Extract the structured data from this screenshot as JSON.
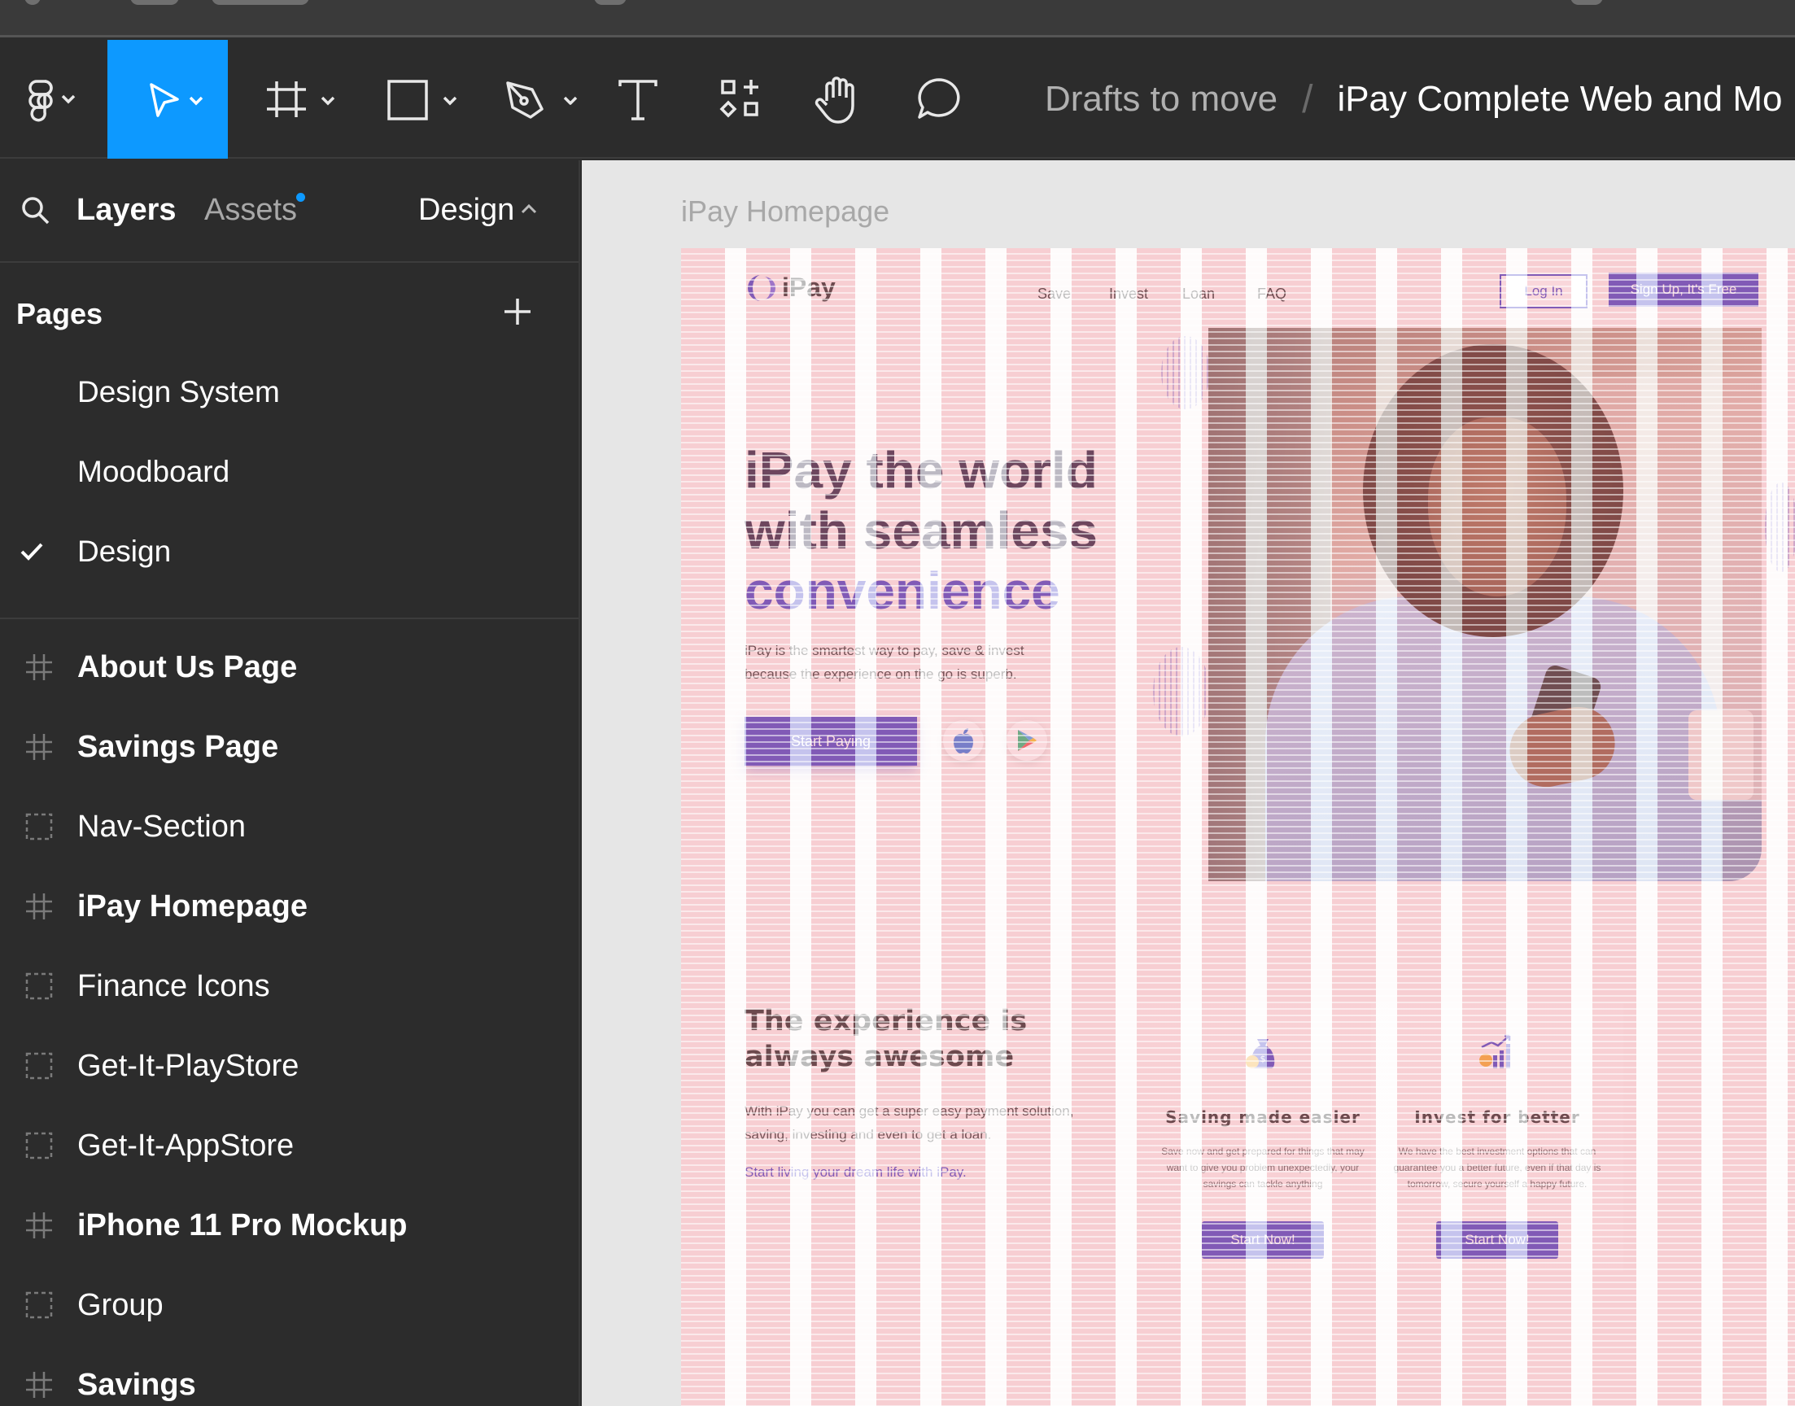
{
  "toolbar": {
    "breadcrumb": {
      "project": "Drafts to move",
      "separator": "/",
      "file": "iPay Complete Web and Mo"
    },
    "tools": [
      "main-menu",
      "move",
      "frame",
      "shape",
      "pen",
      "text",
      "resources",
      "hand",
      "comment"
    ]
  },
  "sidebar": {
    "tabs": {
      "layers": "Layers",
      "assets": "Assets",
      "design": "Design"
    },
    "pages_header": "Pages",
    "pages": [
      {
        "label": "Design System"
      },
      {
        "label": "Moodboard"
      },
      {
        "label": "Design",
        "selected": true
      }
    ],
    "layers": [
      {
        "label": "About Us Page",
        "type": "frame"
      },
      {
        "label": "Savings Page",
        "type": "frame"
      },
      {
        "label": "Nav-Section",
        "type": "group"
      },
      {
        "label": "iPay Homepage",
        "type": "frame"
      },
      {
        "label": "Finance Icons",
        "type": "group"
      },
      {
        "label": "Get-It-PlayStore",
        "type": "group"
      },
      {
        "label": "Get-It-AppStore",
        "type": "group"
      },
      {
        "label": "iPhone 11 Pro Mockup",
        "type": "frame"
      },
      {
        "label": "Group",
        "type": "group"
      },
      {
        "label": "Savings",
        "type": "frame"
      }
    ]
  },
  "canvas": {
    "frame_label": "iPay Homepage",
    "site": {
      "logo": "iPay",
      "nav": [
        "Save",
        "Invest",
        "Loan",
        "FAQ"
      ],
      "login": "Log In",
      "signup": "Sign Up, It's Free",
      "hero_line1": "iPay the world",
      "hero_line2": "with seamless",
      "hero_accent": "convenience",
      "hero_sub": "iPay is the smartest way to pay, save & invest because the experience on the go is superb.",
      "start_paying": "Start Paying",
      "section_title": "The experience is always awesome",
      "section_body": "With iPay you can get a super easy payment solution, saving, investing and even to get a loan.",
      "section_link": "Start living your dream life with iPay.",
      "cards": [
        {
          "title": "Saving made easier",
          "body": "Save now and get prepared for things that may want to give you problem unexpectedly, your savings can tackle anything",
          "button": "Start Now!"
        },
        {
          "title": "Invest for better",
          "body": "We have the best investment options that can guarantee you a better future, even if that day is tomorrow, secure yourself a happy future.",
          "button": "Start Now!"
        }
      ]
    }
  },
  "colors": {
    "accent": "#3d35c4",
    "selection": "#0d99ff",
    "panel": "#2c2c2c"
  }
}
